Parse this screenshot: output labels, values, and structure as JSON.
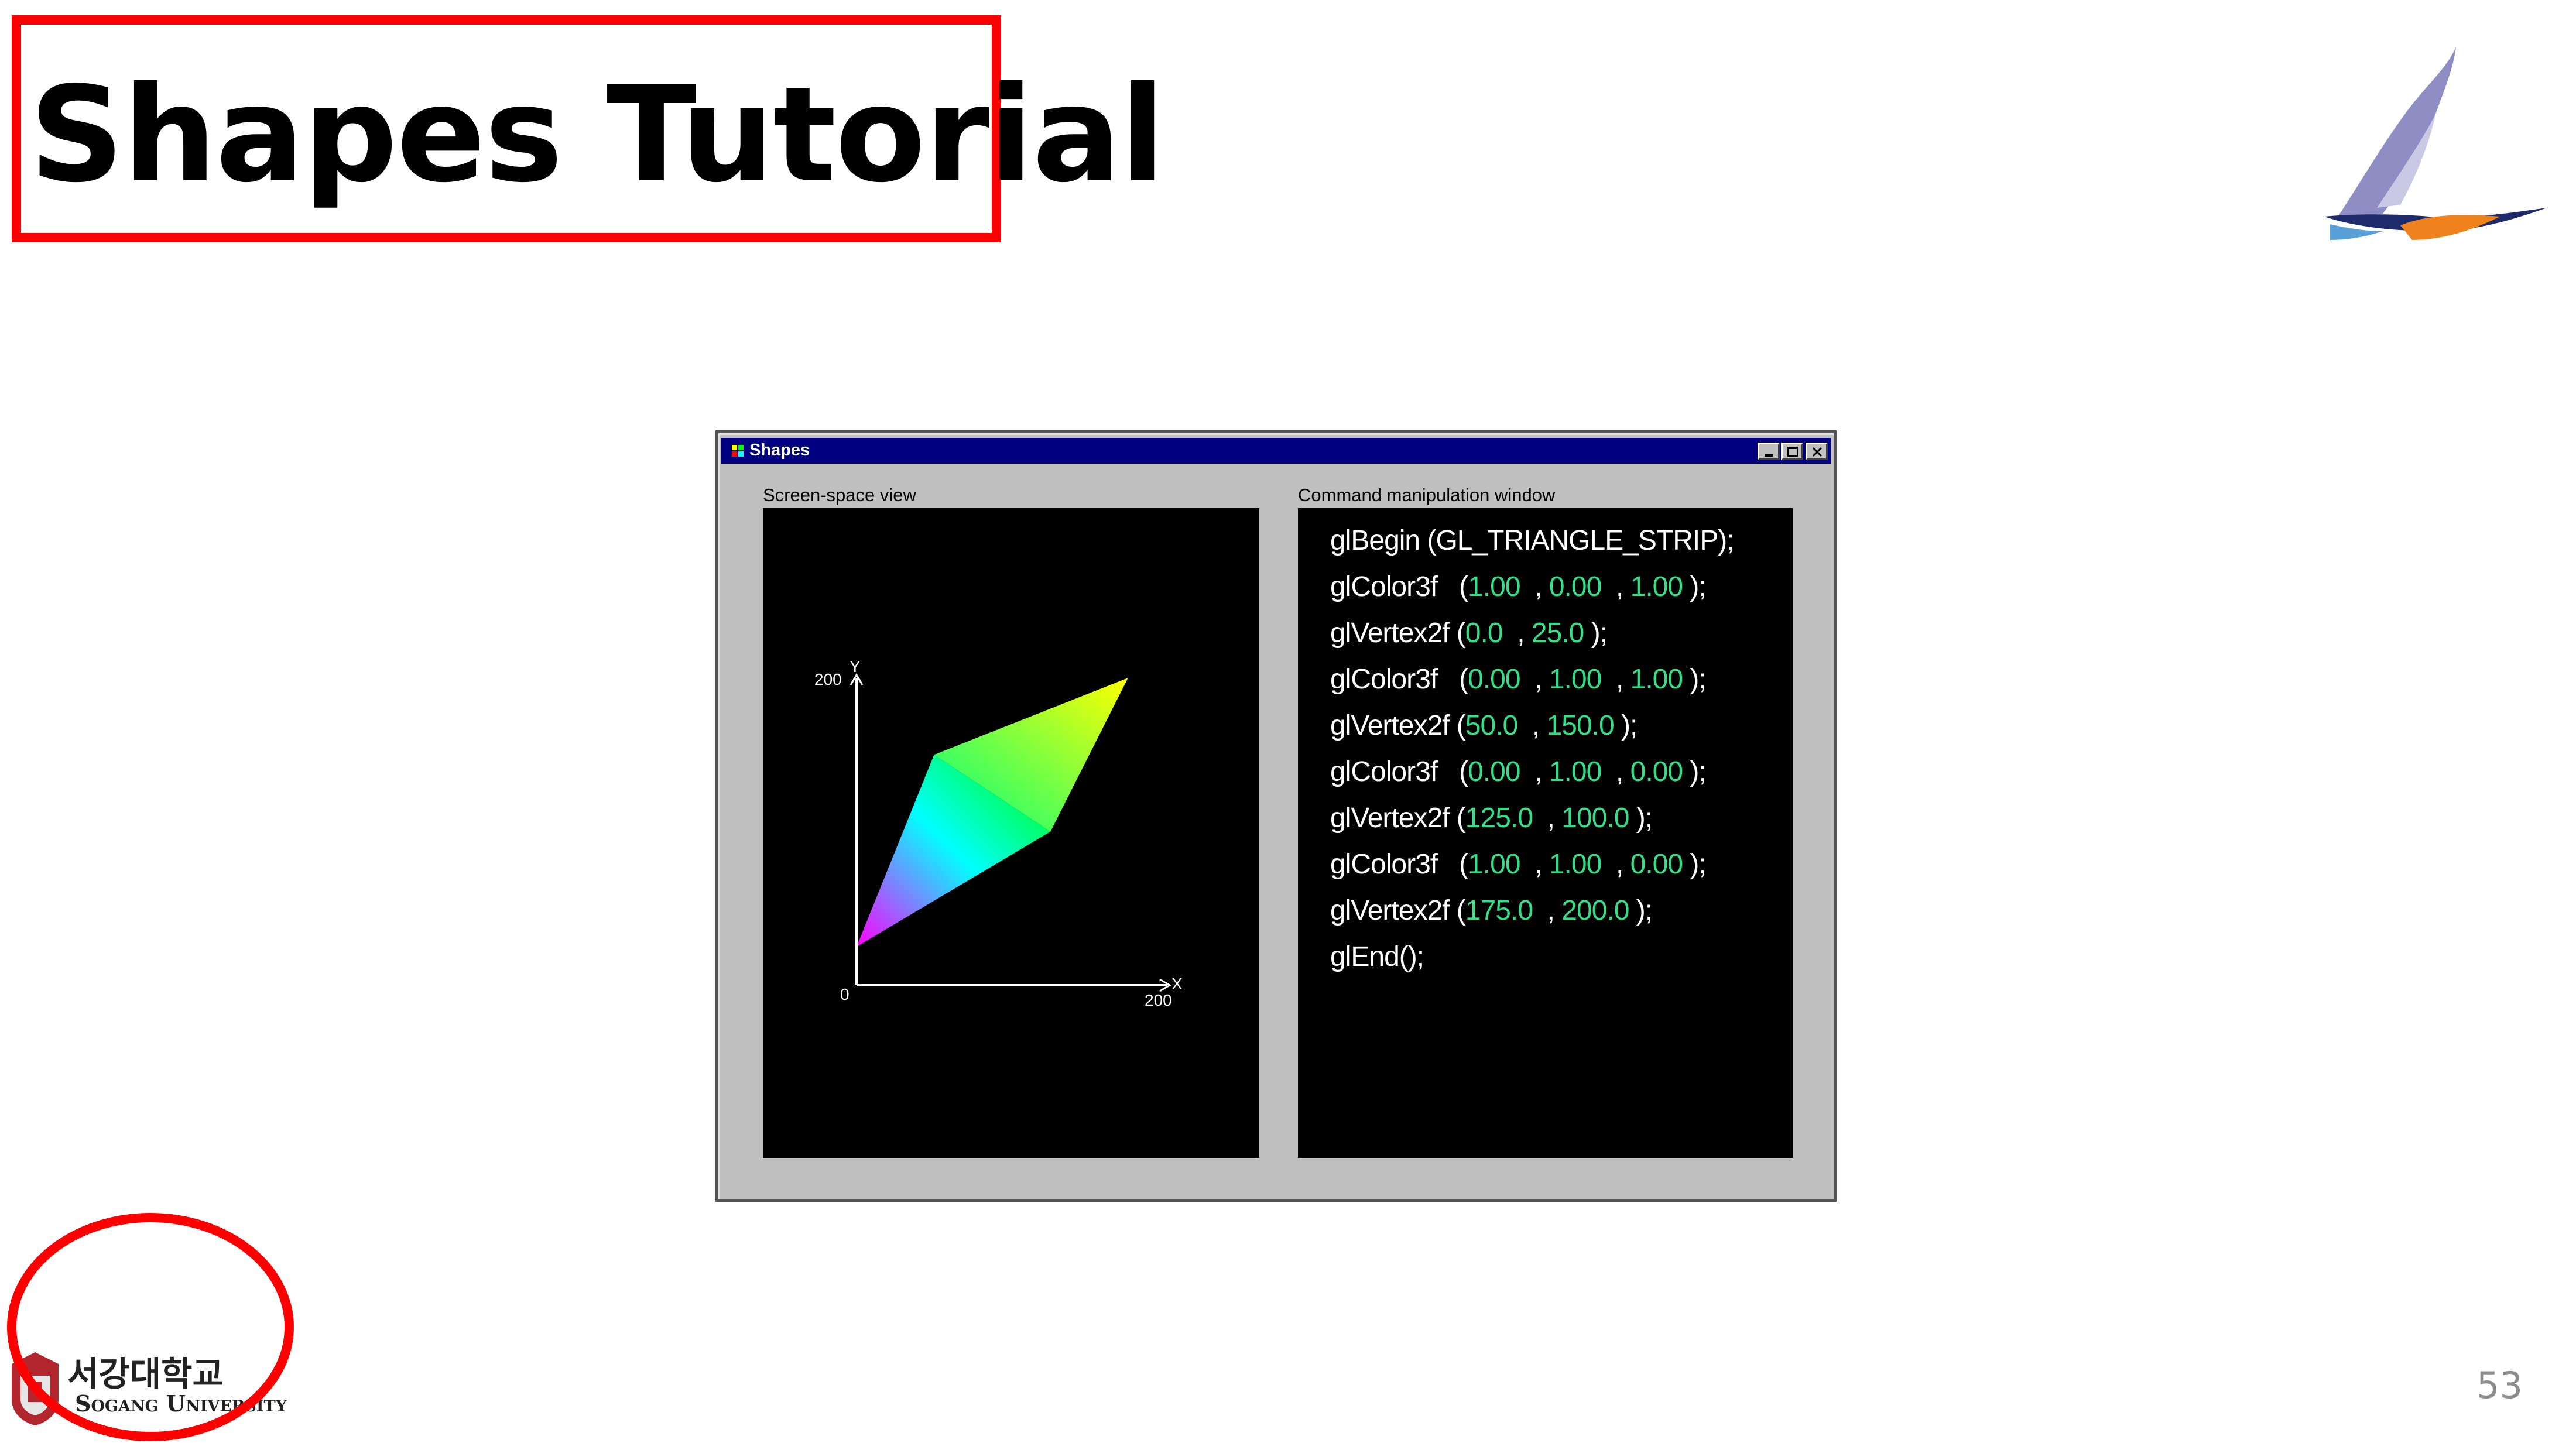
{
  "slide": {
    "title": "Shapes Tutorial",
    "page_number": "53",
    "university_korean": "서강대학교",
    "university_english": "Sogang University"
  },
  "window": {
    "title": "Shapes",
    "titlebar_color": "#000080",
    "left_panel_label": "Screen-space view",
    "right_panel_label": "Command manipulation window",
    "axes": {
      "y_label": "Y",
      "x_label": "X",
      "y_max": "200",
      "x_max": "200",
      "origin": "0"
    },
    "code": [
      {
        "fn": "glBegin",
        "open": " (",
        "args": [],
        "raw": "GL_TRIANGLE_STRIP",
        "close": ");"
      },
      {
        "fn": "glColor3f",
        "open": "   (",
        "args": [
          "1.00",
          "0.00",
          "1.00"
        ],
        "close": " );"
      },
      {
        "fn": "glVertex2f",
        "open": " (",
        "args": [
          "0.0",
          "25.0"
        ],
        "close": " );"
      },
      {
        "fn": "glColor3f",
        "open": "   (",
        "args": [
          "0.00",
          "1.00",
          "1.00"
        ],
        "close": " );"
      },
      {
        "fn": "glVertex2f",
        "open": " (",
        "args": [
          "50.0",
          "150.0"
        ],
        "close": " );"
      },
      {
        "fn": "glColor3f",
        "open": "   (",
        "args": [
          "0.00",
          "1.00",
          "0.00"
        ],
        "close": " );"
      },
      {
        "fn": "glVertex2f",
        "open": " (",
        "args": [
          "125.0",
          "100.0"
        ],
        "close": " );"
      },
      {
        "fn": "glColor3f",
        "open": "   (",
        "args": [
          "1.00",
          "1.00",
          "0.00"
        ],
        "close": " );"
      },
      {
        "fn": "glVertex2f",
        "open": " (",
        "args": [
          "175.0",
          "200.0"
        ],
        "close": " );"
      },
      {
        "fn": "glEnd();",
        "open": "",
        "args": [],
        "close": ""
      }
    ],
    "vertices": [
      {
        "x": 0.0,
        "y": 25.0,
        "color": "#ff00ff"
      },
      {
        "x": 50.0,
        "y": 150.0,
        "color": "#00ffff"
      },
      {
        "x": 125.0,
        "y": 100.0,
        "color": "#00ff00"
      },
      {
        "x": 175.0,
        "y": 200.0,
        "color": "#ffff00"
      }
    ],
    "number_color": "#33e089"
  }
}
